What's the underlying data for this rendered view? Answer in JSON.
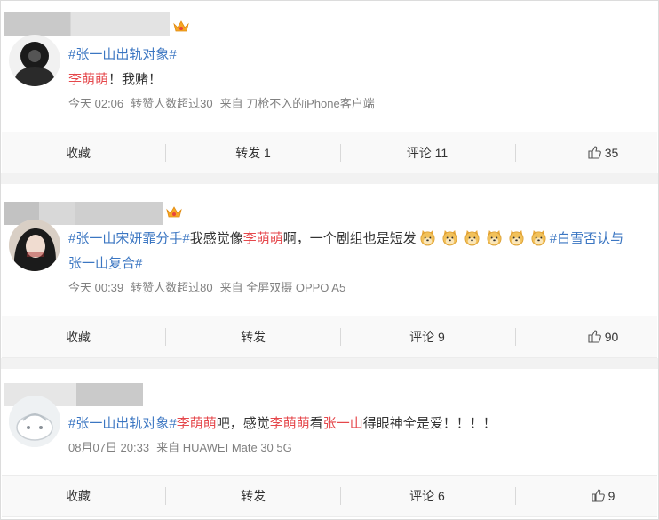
{
  "emoji_name": "doge-emoji",
  "posts": [
    {
      "segments": [
        {
          "t": "#张一山出轨对象#",
          "c": "tag"
        }
      ],
      "line2": [
        {
          "t": "李萌萌",
          "c": "red"
        },
        {
          "t": "！我赌！",
          "c": ""
        }
      ],
      "time": "今天 02:06",
      "reposts_info": "转赞人数超过30",
      "source": "来自 刀枪不入的iPhone客户端",
      "actions": {
        "collect": "收藏",
        "repost": "转发 1",
        "comment": "评论 11",
        "like": "35"
      }
    },
    {
      "line1": [
        {
          "t": "#张一山宋妍霏分手#",
          "c": "tag"
        },
        {
          "t": "我感觉像",
          "c": ""
        },
        {
          "t": "李萌萌",
          "c": "red"
        },
        {
          "t": "啊，一个剧组也是短发",
          "c": ""
        }
      ],
      "emoji_count": 6,
      "line1_tail": "#白雪否认与",
      "line2": "张一山复合#",
      "time": "今天 00:39",
      "reposts_info": "转赞人数超过80",
      "source": "来自 全屏双摄 OPPO A5",
      "actions": {
        "collect": "收藏",
        "repost": "转发",
        "comment": "评论 9",
        "like": "90"
      }
    },
    {
      "line1": [
        {
          "t": "#张一山出轨对象#",
          "c": "tag"
        },
        {
          "t": "李萌萌",
          "c": "red"
        },
        {
          "t": "吧，感觉",
          "c": ""
        },
        {
          "t": "李萌萌",
          "c": "red"
        },
        {
          "t": "看",
          "c": ""
        },
        {
          "t": "张一山",
          "c": "red"
        },
        {
          "t": "得眼神全是爱！！！！",
          "c": ""
        }
      ],
      "time": "08月07日 20:33",
      "source": "来自 HUAWEI Mate 30 5G",
      "actions": {
        "collect": "收藏",
        "repost": "转发",
        "comment": "评论 6",
        "like": "9"
      }
    }
  ]
}
